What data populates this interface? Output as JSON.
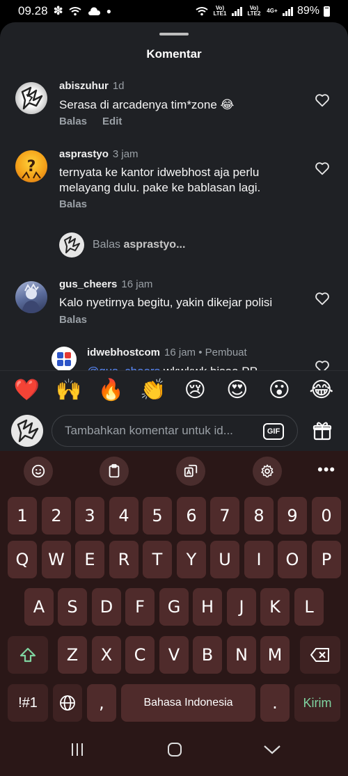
{
  "status_bar": {
    "time": "09.28",
    "sim1_label": "Vo) LTE1",
    "sim2_label": "Vo) LTE2",
    "network_type": "4G+",
    "battery": "89%"
  },
  "sheet": {
    "title": "Komentar"
  },
  "comments": [
    {
      "username": "abiszuhur",
      "time": "1d",
      "text": "Serasa di arcadenya tim*zone 😂",
      "reply_label": "Balas",
      "edit_label": "Edit"
    },
    {
      "username": "asprastyo",
      "time": "3 jam",
      "text": "ternyata ke kantor idwebhost aja perlu melayang dulu. pake ke bablasan lagi.",
      "reply_label": "Balas"
    },
    {
      "username": "gus_cheers",
      "time": "16 jam",
      "text": "Kalo nyetirnya begitu, yakin dikejar polisi",
      "reply_label": "Balas"
    }
  ],
  "reply_prompt": {
    "prefix": "Balas",
    "target": "asprastyo..."
  },
  "reply": {
    "username": "idwebhostcom",
    "time": "16 jam",
    "badge": "• Pembuat",
    "mention": "@gus_cheers",
    "text": "wkwkwk bisaa PP"
  },
  "emoji_bar": [
    "❤️",
    "🙌",
    "🔥",
    "👏",
    "😢",
    "😍",
    "😮",
    "😂"
  ],
  "composer": {
    "placeholder": "Tambahkan komentar untuk id...",
    "gif_label": "GIF"
  },
  "keyboard": {
    "toolbar_more": "•••",
    "row_numbers": [
      "1",
      "2",
      "3",
      "4",
      "5",
      "6",
      "7",
      "8",
      "9",
      "0"
    ],
    "row_top": [
      "Q",
      "W",
      "E",
      "R",
      "T",
      "Y",
      "U",
      "I",
      "O",
      "P"
    ],
    "row_home": [
      "A",
      "S",
      "D",
      "F",
      "G",
      "H",
      "J",
      "K",
      "L"
    ],
    "row_bottom": [
      "Z",
      "X",
      "C",
      "V",
      "B",
      "N",
      "M"
    ],
    "symbols_label": "!#1",
    "comma": ",",
    "space_label": "Bahasa Indonesia",
    "period": ".",
    "send_label": "Kirim"
  },
  "colors": {
    "sheet_bg": "#1f2125",
    "keyboard_bg": "#2a1717",
    "key_bg": "#4f2b2b",
    "send_color": "#7fd4a0",
    "mention_color": "#5b8cff"
  }
}
